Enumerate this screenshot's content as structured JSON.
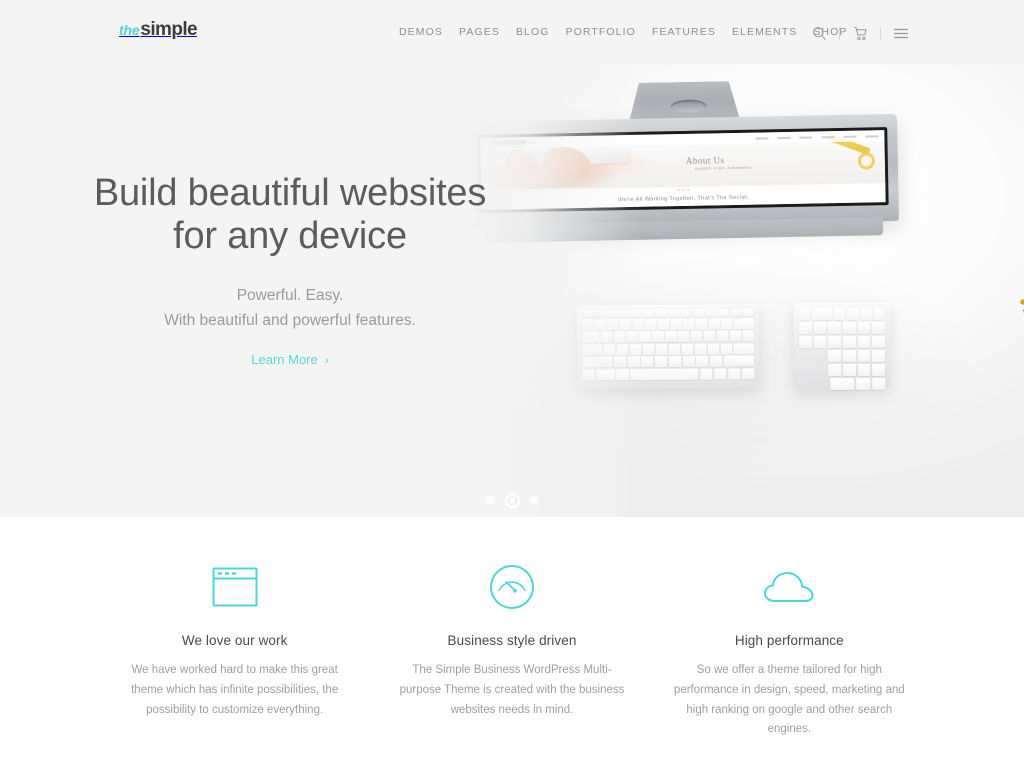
{
  "brand": {
    "logo_prefix": "the",
    "logo_name": "simple",
    "accent_color": "#4fd4d8",
    "cta_color": "#5fd5d0"
  },
  "header": {
    "nav": [
      {
        "label": "DEMOS",
        "name": "nav-item-demos"
      },
      {
        "label": "PAGES",
        "name": "nav-item-pages"
      },
      {
        "label": "BLOG",
        "name": "nav-item-blog"
      },
      {
        "label": "PORTFOLIO",
        "name": "nav-item-portfolio"
      },
      {
        "label": "FEATURES",
        "name": "nav-item-features"
      },
      {
        "label": "ELEMENTS",
        "name": "nav-item-elements"
      },
      {
        "label": "SHOP",
        "name": "nav-item-shop"
      }
    ],
    "icons": [
      {
        "name": "search-icon"
      },
      {
        "name": "cart-icon"
      },
      {
        "name": "hamburger-menu-icon"
      }
    ]
  },
  "hero": {
    "title_line1": "Build beautiful websites",
    "title_line2": "for any device",
    "subtitle_line1": "Powerful. Easy.",
    "subtitle_line2": "With beautiful and powerful features.",
    "cta_label": "Learn More",
    "cta_chevron": "›",
    "background_color": "#f4f4f4",
    "slider": {
      "total": 3,
      "active_index": 1
    },
    "screen_content": {
      "heading": "About Us",
      "subheading": "A passion. A style. A masterpiece.",
      "caption": "We're All Working Together, That's The Secret."
    }
  },
  "features": [
    {
      "icon": "browser-window-icon",
      "title": "We love our work",
      "description": "We have worked hard to make this great theme which has infinite possibilities, the possibility to customize everything."
    },
    {
      "icon": "speedometer-gauge-icon",
      "title": "Business style driven",
      "description": "The Simple Business WordPress Multi-purpose Theme is created with the business websites needs in mind."
    },
    {
      "icon": "cloud-icon",
      "title": "High performance",
      "description": "So we offer a theme tailored for high performance in design, speed, marketing and high ranking on google and other search engines."
    }
  ]
}
